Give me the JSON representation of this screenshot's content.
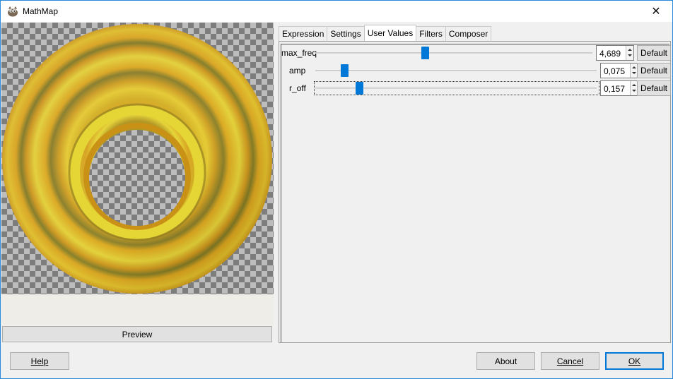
{
  "window": {
    "title": "MathMap",
    "close_symbol": "✕",
    "app_icon": "gimp-wilber-icon"
  },
  "preview": {
    "button_label": "Preview"
  },
  "tabs": [
    {
      "label": "Expression",
      "active": false
    },
    {
      "label": "Settings",
      "active": false
    },
    {
      "label": "User Values",
      "active": true
    },
    {
      "label": "Filters",
      "active": false
    },
    {
      "label": "Composer",
      "active": false
    }
  ],
  "user_values": [
    {
      "label": "max_freq",
      "value": "4,689",
      "slider_fraction": 0.395,
      "default_label": "Default"
    },
    {
      "label": "amp",
      "value": "0,075",
      "slider_fraction": 0.075,
      "default_label": "Default"
    },
    {
      "label": "r_off",
      "value": "0,157",
      "slider_fraction": 0.157,
      "default_label": "Default"
    }
  ],
  "buttons": {
    "help": "Help",
    "about": "About",
    "cancel": "Cancel",
    "ok": "OK"
  },
  "colors": {
    "accent": "#0078d7",
    "ring_gold": "#d9a01a",
    "ring_light": "#e4d534",
    "ring_shadow": "#6e6a1e"
  }
}
